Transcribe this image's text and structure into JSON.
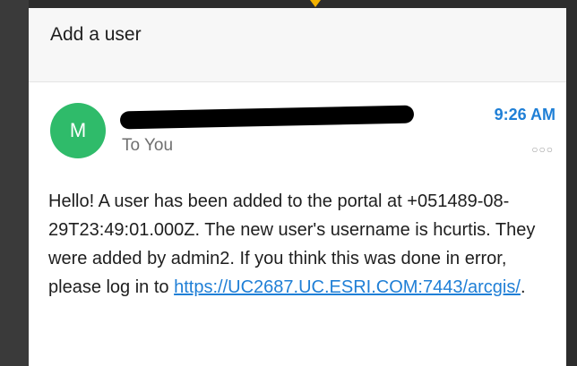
{
  "header": {
    "title": "Add a user"
  },
  "message": {
    "avatar_initial": "M",
    "sender_redacted": true,
    "time": "9:26 AM",
    "to_label": "To You",
    "more_icon": "more-horizontal-icon",
    "body": "Hello! A user has been added to the portal at +051489-08-29T23:49:01.000Z. The new user's username is hcurtis. They were added by admin2. If you think this was done in error, please log in to ",
    "link": "https://UC2687.UC.ESRI.COM:7443/arcgis/",
    "body_end": "."
  },
  "colors": {
    "accent": "#1f7fd6",
    "avatar": "#2fbb6a",
    "arrow": "#f2b100"
  }
}
